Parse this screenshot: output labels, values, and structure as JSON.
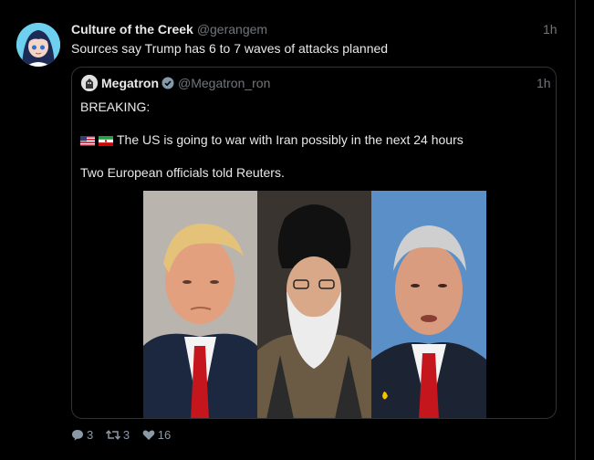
{
  "tweet": {
    "author_name": "Culture of the Creek",
    "author_handle": "@gerangem",
    "time": "1h",
    "text": "Sources say Trump has 6 to 7 waves of attacks planned"
  },
  "quote": {
    "author_name": "Megatron",
    "author_handle": "@Megatron_ron",
    "time": "1h",
    "line1": "BREAKING:",
    "line2": "The US is going to war with Iran possibly in the next 24 hours",
    "line3": "Two European officials told Reuters.",
    "flag_icons": [
      "us-flag-icon",
      "iran-flag-icon"
    ],
    "verified_icon": "verified-badge-icon",
    "image_panels": [
      "person-dark-suit-red-tie",
      "person-black-turban-beard",
      "person-grey-hair-red-tie"
    ]
  },
  "actions": {
    "replies": "3",
    "retweets": "3",
    "likes": "16",
    "icons": [
      "reply-icon",
      "retweet-icon",
      "like-icon"
    ]
  },
  "colors": {
    "background": "#000000",
    "text": "#e7e9ea",
    "muted": "#71767b",
    "border": "#2f3336",
    "action": "#8b98a5"
  }
}
